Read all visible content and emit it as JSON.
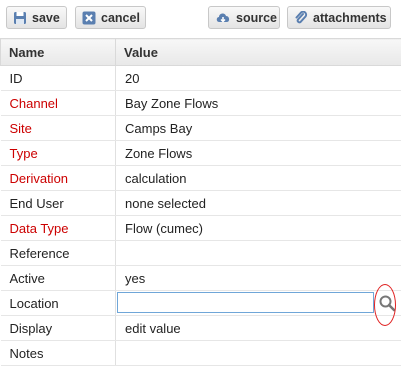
{
  "toolbar": {
    "save_label": "save",
    "cancel_label": "cancel",
    "source_label": "source",
    "attachments_label": "attachments"
  },
  "table": {
    "headers": {
      "name": "Name",
      "value": "Value"
    },
    "rows": [
      {
        "name": "ID",
        "value": "20",
        "required": false
      },
      {
        "name": "Channel",
        "value": "Bay Zone Flows",
        "required": true
      },
      {
        "name": "Site",
        "value": "Camps Bay",
        "required": true
      },
      {
        "name": "Type",
        "value": "Zone Flows",
        "required": true
      },
      {
        "name": "Derivation",
        "value": "calculation",
        "required": true
      },
      {
        "name": "End User",
        "value": "none selected",
        "required": false
      },
      {
        "name": "Data Type",
        "value": "Flow (cumec)",
        "required": true
      },
      {
        "name": "Reference",
        "value": "",
        "required": false
      },
      {
        "name": "Active",
        "value": "yes",
        "required": false
      },
      {
        "name": "Location",
        "value": "",
        "required": false
      },
      {
        "name": "Display",
        "value": "edit value",
        "required": false
      },
      {
        "name": "Notes",
        "value": "",
        "required": false
      }
    ]
  },
  "colors": {
    "required_label": "#cc0000",
    "input_border": "#6fa6d8",
    "annotation": "#e02020"
  },
  "icons": [
    "save-icon",
    "cancel-icon",
    "cloud-download-icon",
    "paperclip-icon",
    "search-icon"
  ]
}
